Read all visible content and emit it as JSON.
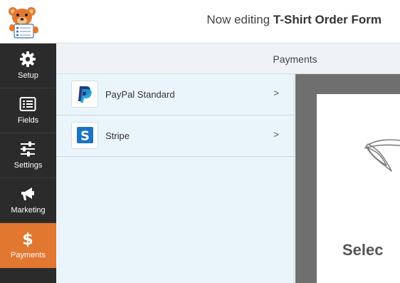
{
  "header": {
    "title_prefix": "Now editing",
    "form_name": "T-Shirt Order Form",
    "logo": "wpforms-bear-logo"
  },
  "sidebar": {
    "items": [
      {
        "label": "Setup",
        "icon": "gear-icon",
        "active": false
      },
      {
        "label": "Fields",
        "icon": "fields-list-icon",
        "active": false
      },
      {
        "label": "Settings",
        "icon": "sliders-icon",
        "active": false
      },
      {
        "label": "Marketing",
        "icon": "megaphone-icon",
        "active": false
      },
      {
        "label": "Payments",
        "icon": "dollar-icon",
        "active": true
      }
    ]
  },
  "section": {
    "title": "Payments"
  },
  "payments": {
    "items": [
      {
        "label": "PayPal Standard",
        "icon": "paypal-icon",
        "chevron": ">"
      },
      {
        "label": "Stripe",
        "icon": "stripe-icon",
        "chevron": ">"
      }
    ]
  },
  "preview": {
    "text": "Selec"
  },
  "colors": {
    "sidebar": "#2b2b2b",
    "active": "#e27730",
    "list_bg": "#eaf4fb",
    "preview_bg": "#6f6f6f",
    "paypal_dark": "#253b80",
    "paypal_light": "#179bd7",
    "stripe": "#1a73c4"
  }
}
